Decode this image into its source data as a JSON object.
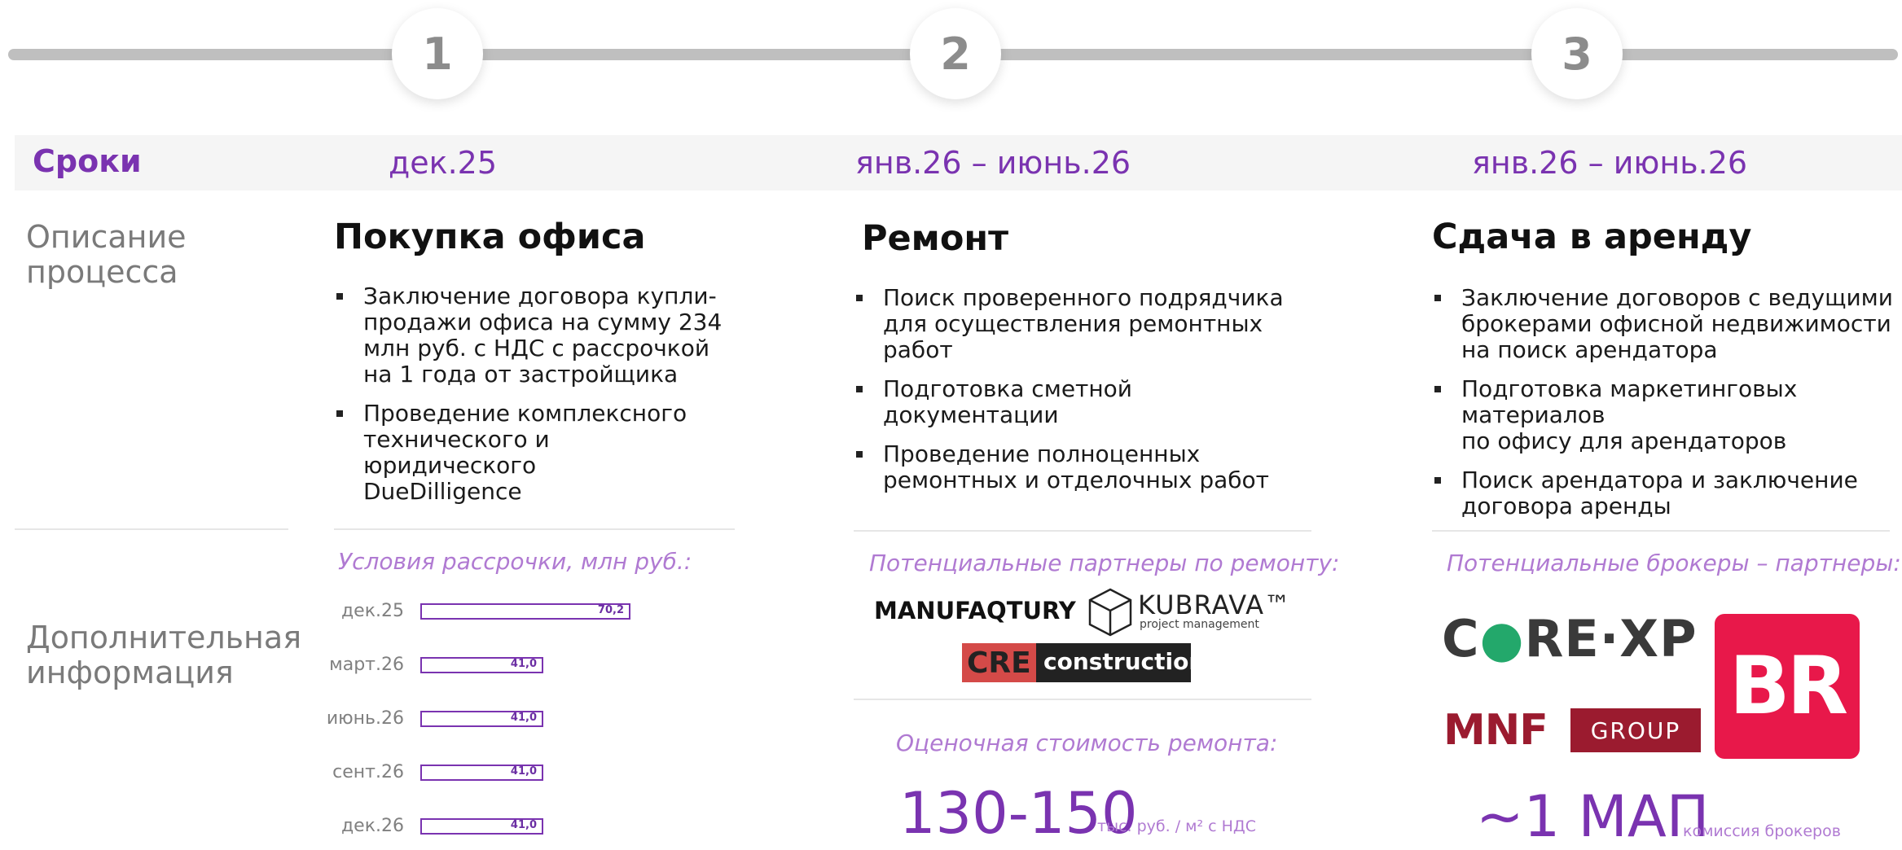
{
  "timeline": {
    "steps": [
      "1",
      "2",
      "3"
    ]
  },
  "header": {
    "label": "Сроки",
    "dates": [
      "дек.25",
      "янв.26 – июнь.26",
      "янв.26 – июнь.26"
    ]
  },
  "row_labels": {
    "process": [
      "Описание",
      "процесса"
    ],
    "extra": [
      "Дополнительная",
      "информация"
    ]
  },
  "columns": [
    {
      "title": "Покупка офиса",
      "bullets": [
        [
          "Заключение договора купли-",
          "продажи офиса на сумму 234",
          "млн руб. с НДС  с рассрочкой",
          "на 1 года от застройщика"
        ],
        [
          "Проведение комплексного",
          "технического и юридического",
          "DueDilligence"
        ]
      ],
      "subhead": "Условия рассрочки, млн руб.:"
    },
    {
      "title": "Ремонт",
      "bullets": [
        [
          "Поиск проверенного подрядчика",
          "для осуществления ремонтных",
          "работ"
        ],
        [
          "Подготовка сметной",
          "документации"
        ],
        [
          "Проведение полноценных",
          "ремонтных и отделочных работ"
        ]
      ],
      "subhead": "Потенциальные партнеры по ремонту:",
      "partners": {
        "manufaqtury": "MANUFAQTURY",
        "kubrava_name": "KUBRAVA™",
        "kubrava_sub": "project management",
        "cre_a": "CRE",
        "cre_b": "construction"
      },
      "cost_label": "Оценочная стоимость ремонта:",
      "cost_value": "130-150",
      "cost_unit": "тыс. руб. / м² с НДС"
    },
    {
      "title": "Сдача в аренду",
      "bullets": [
        [
          "Заключение договоров с ведущими",
          "брокерами офисной недвижимости",
          "на поиск арендатора"
        ],
        [
          "Подготовка маркетинговых материалов",
          "по офису для арендаторов"
        ],
        [
          "Поиск арендатора и заключение",
          "договора аренды"
        ]
      ],
      "subhead": "Потенциальные брокеры – партнеры:",
      "brokers": {
        "core_a": "C",
        "core_b": "RE·XP",
        "br": "BR",
        "mnf": "MNF",
        "group": "GROUP"
      },
      "fee_value": "~1 МАП",
      "fee_label": "комиссия брокеров"
    }
  ],
  "chart_data": {
    "type": "bar",
    "orientation": "horizontal",
    "title": "Условия рассрочки, млн руб.:",
    "categories": [
      "дек.25",
      "март.26",
      "июнь.26",
      "сент.26",
      "дек.26"
    ],
    "values": [
      70.2,
      41.0,
      41.0,
      41.0,
      41.0
    ],
    "value_labels": [
      "70,2",
      "41,0",
      "41,0",
      "41,0",
      "41,0"
    ],
    "bar_color": "#7a33b0",
    "xlim": [
      0,
      70.2
    ]
  },
  "colors": {
    "accent": "#7a33b0",
    "accent_light": "#b07ad2",
    "step_circle": "#ffffff",
    "timeline": "#bfbfbf"
  }
}
